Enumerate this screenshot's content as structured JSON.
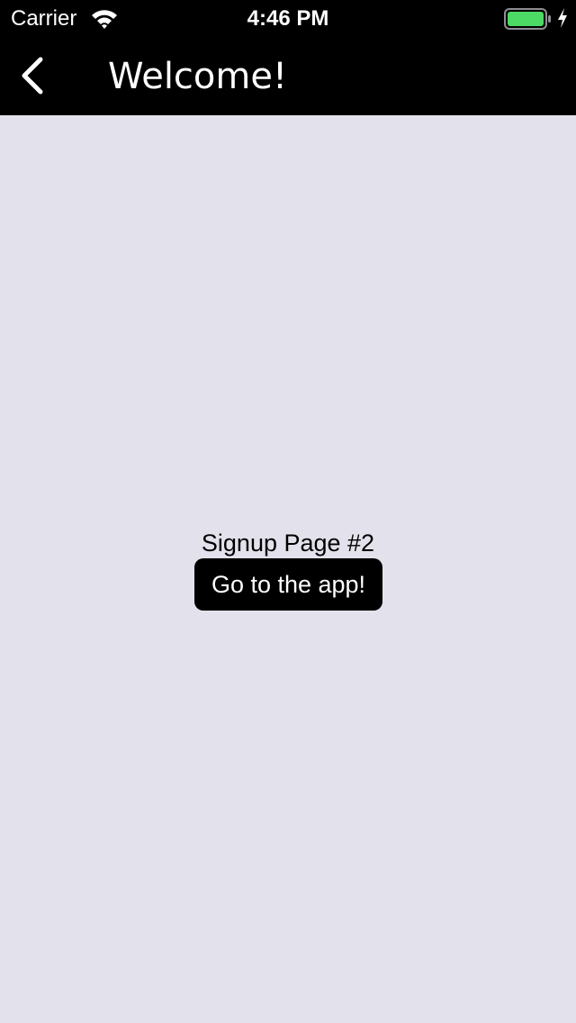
{
  "status_bar": {
    "carrier": "Carrier",
    "time": "4:46 PM",
    "icons": {
      "wifi": "wifi-icon",
      "battery": "battery-icon",
      "charging": "charging-bolt-icon"
    },
    "battery_level": 1.0,
    "battery_color": "#4cd964"
  },
  "nav_bar": {
    "title": "Welcome!",
    "back_icon": "chevron-left-icon"
  },
  "main": {
    "page_label": "Signup Page #2",
    "go_button_label": "Go to the app!"
  },
  "colors": {
    "background": "#e3e2ec",
    "bars": "#000000",
    "button": "#000000"
  }
}
